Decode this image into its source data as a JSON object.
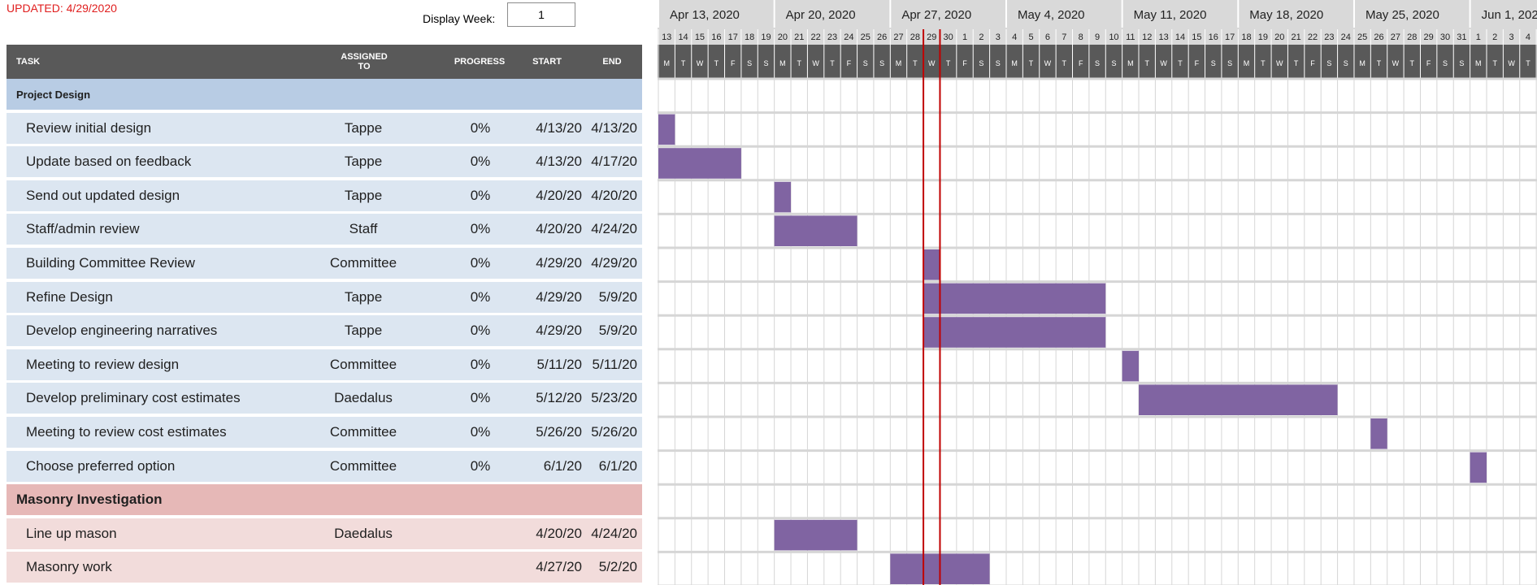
{
  "updated_text": "UPDATED: 4/29/2020",
  "display_week": {
    "label": "Display Week:",
    "value": "1"
  },
  "columns": {
    "task": "TASK",
    "assigned_line1": "ASSIGNED",
    "assigned_line2": "TO",
    "progress": "PROGRESS",
    "start": "START",
    "end": "END"
  },
  "colors": {
    "section1_bg": "#b8cce4",
    "section1_row_bg": "#dce6f1",
    "section2_bg": "#e6b8b7",
    "section2_row_bg": "#f2dcdb",
    "bar": "#8064a2",
    "today_line": "#c00000",
    "header_bg": "#595959",
    "timeline_header_bg": "#d9d9d9"
  },
  "timeline": {
    "weeks": [
      "Apr 13, 2020",
      "Apr 20, 2020",
      "Apr 27, 2020",
      "May 4, 2020",
      "May 11, 2020",
      "May 18, 2020",
      "May 25, 2020",
      "Jun 1, 2020"
    ],
    "day_numbers": [
      "13",
      "14",
      "15",
      "16",
      "17",
      "18",
      "19",
      "20",
      "21",
      "22",
      "23",
      "24",
      "25",
      "26",
      "27",
      "28",
      "29",
      "30",
      "1",
      "2",
      "3",
      "4",
      "5",
      "6",
      "7",
      "8",
      "9",
      "10",
      "11",
      "12",
      "13",
      "14",
      "15",
      "16",
      "17",
      "18",
      "19",
      "20",
      "21",
      "22",
      "23",
      "24",
      "25",
      "26",
      "27",
      "28",
      "29",
      "30",
      "31",
      "1",
      "2",
      "3",
      "4"
    ],
    "day_letters": [
      "M",
      "T",
      "W",
      "T",
      "F",
      "S",
      "S"
    ],
    "today_day_index": 16
  },
  "sections": [
    {
      "name": "Project Design",
      "tasks": [
        {
          "name": "Review initial design",
          "assigned": "Tappe",
          "progress": "0%",
          "start": "4/13/20",
          "end": "4/13/20",
          "bar": [
            0,
            1
          ]
        },
        {
          "name": "Update based on feedback",
          "assigned": "Tappe",
          "progress": "0%",
          "start": "4/13/20",
          "end": "4/17/20",
          "bar": [
            0,
            5
          ]
        },
        {
          "name": "Send out updated design",
          "assigned": "Tappe",
          "progress": "0%",
          "start": "4/20/20",
          "end": "4/20/20",
          "bar": [
            7,
            1
          ]
        },
        {
          "name": "Staff/admin review",
          "assigned": "Staff",
          "progress": "0%",
          "start": "4/20/20",
          "end": "4/24/20",
          "bar": [
            7,
            5
          ]
        },
        {
          "name": "Building Committee Review",
          "assigned": "Committee",
          "progress": "0%",
          "start": "4/29/20",
          "end": "4/29/20",
          "bar": [
            16,
            1
          ]
        },
        {
          "name": "Refine Design",
          "assigned": "Tappe",
          "progress": "0%",
          "start": "4/29/20",
          "end": "5/9/20",
          "bar": [
            16,
            11
          ]
        },
        {
          "name": "Develop engineering narratives",
          "assigned": "Tappe",
          "progress": "0%",
          "start": "4/29/20",
          "end": "5/9/20",
          "bar": [
            16,
            11
          ]
        },
        {
          "name": "Meeting to review design",
          "assigned": "Committee",
          "progress": "0%",
          "start": "5/11/20",
          "end": "5/11/20",
          "bar": [
            28,
            1
          ]
        },
        {
          "name": "Develop preliminary cost estimates",
          "assigned": "Daedalus",
          "progress": "0%",
          "start": "5/12/20",
          "end": "5/23/20",
          "bar": [
            29,
            12
          ]
        },
        {
          "name": "Meeting to review cost estimates",
          "assigned": "Committee",
          "progress": "0%",
          "start": "5/26/20",
          "end": "5/26/20",
          "bar": [
            43,
            1
          ]
        },
        {
          "name": "Choose preferred option",
          "assigned": "Committee",
          "progress": "0%",
          "start": "6/1/20",
          "end": "6/1/20",
          "bar": [
            49,
            1
          ]
        }
      ]
    },
    {
      "name": "Masonry Investigation",
      "tasks": [
        {
          "name": "Line up mason",
          "assigned": "Daedalus",
          "progress": "",
          "start": "4/20/20",
          "end": "4/24/20",
          "bar": [
            7,
            5
          ]
        },
        {
          "name": "Masonry work",
          "assigned": "",
          "progress": "",
          "start": "4/27/20",
          "end": "5/2/20",
          "bar": [
            14,
            6
          ]
        }
      ]
    }
  ]
}
